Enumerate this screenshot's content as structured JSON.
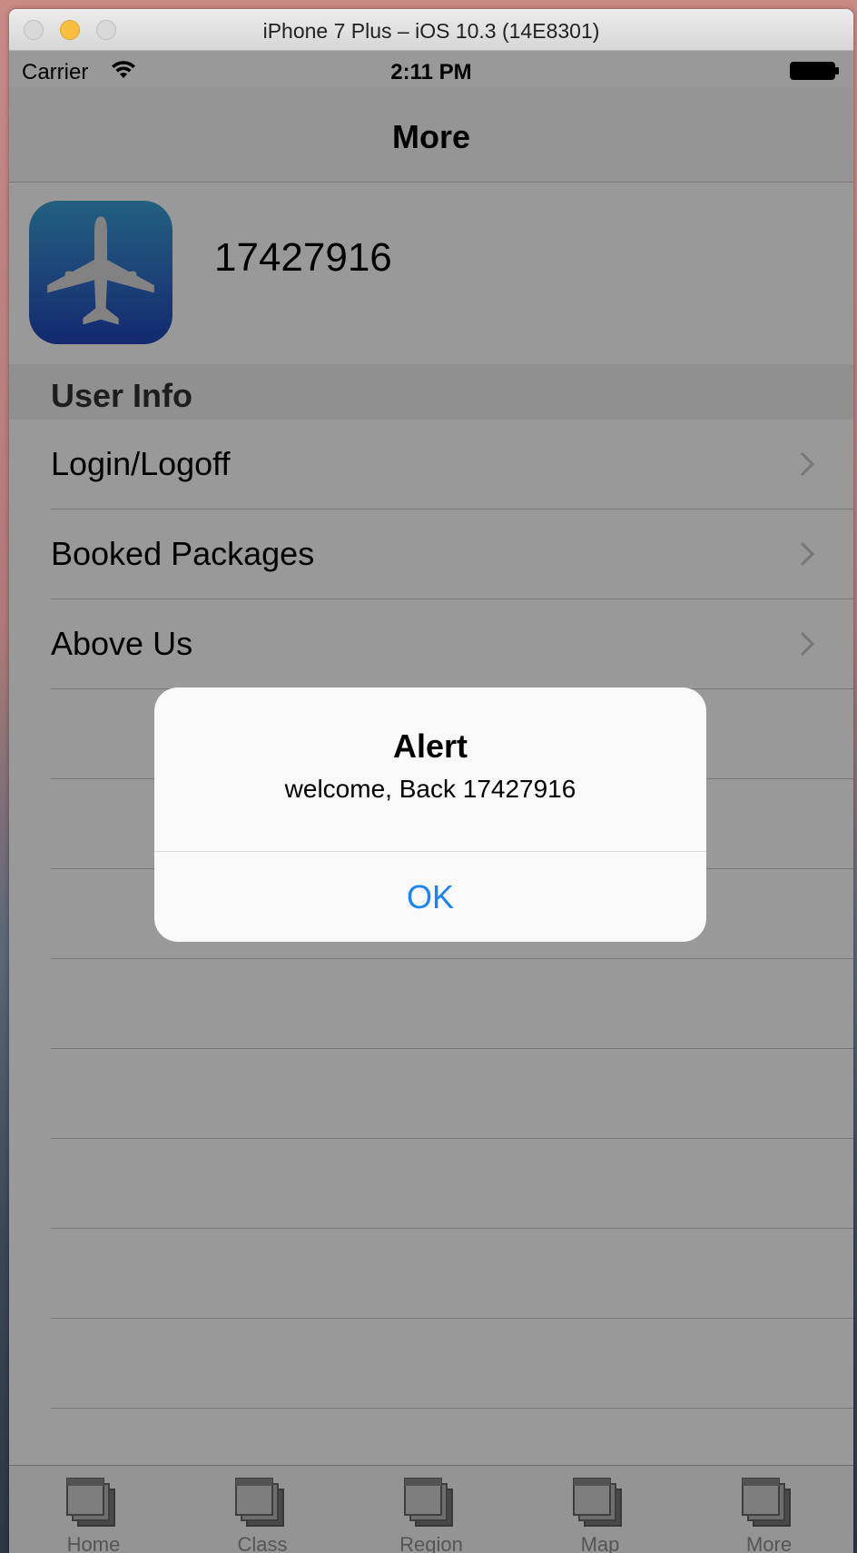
{
  "window": {
    "title": "iPhone 7 Plus – iOS 10.3 (14E8301)"
  },
  "status_bar": {
    "carrier": "Carrier",
    "time": "2:11 PM"
  },
  "nav": {
    "title": "More"
  },
  "profile": {
    "user_number": "17427916"
  },
  "section": {
    "title": "User Info"
  },
  "rows": [
    {
      "label": "Login/Logoff"
    },
    {
      "label": "Booked Packages"
    },
    {
      "label": "Above Us"
    }
  ],
  "tabs": [
    {
      "label": "Home"
    },
    {
      "label": "Class"
    },
    {
      "label": "Region"
    },
    {
      "label": "Map"
    },
    {
      "label": "More"
    }
  ],
  "alert": {
    "title": "Alert",
    "message": "welcome, Back 17427916",
    "ok_label": "OK"
  },
  "colors": {
    "accent": "#1a82fb",
    "app_icon_top": "#3aa0d6",
    "app_icon_bottom": "#1f45b8"
  },
  "icons": {
    "app_icon": "airplane-icon",
    "tab_icon": "stacked-windows-icon",
    "row_accessory": "chevron-right-icon"
  }
}
